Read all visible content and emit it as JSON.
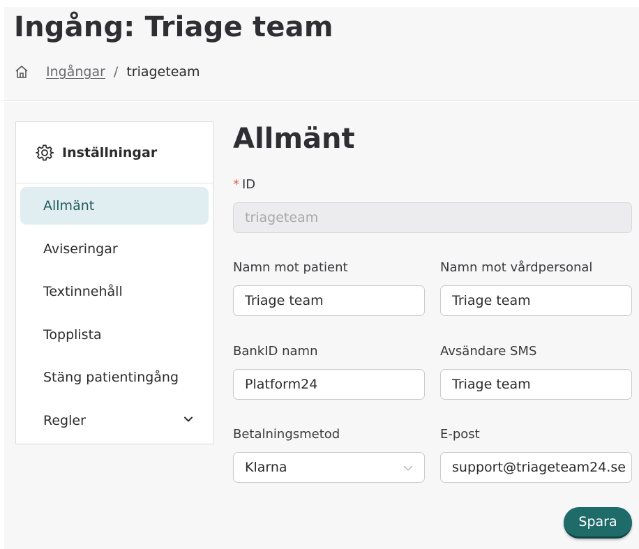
{
  "header": {
    "title": "Ingång: Triage team",
    "breadcrumb": {
      "home_icon": "home-icon",
      "link": "Ingångar",
      "separator": "/",
      "current": "triageteam"
    }
  },
  "sidebar": {
    "title": "Inställningar",
    "title_icon": "gear-icon",
    "items": [
      {
        "label": "Allmänt",
        "active": true
      },
      {
        "label": "Aviseringar"
      },
      {
        "label": "Textinnehåll"
      },
      {
        "label": "Topplista"
      },
      {
        "label": "Stäng patientingång"
      },
      {
        "label": "Regler",
        "icon": "chevron-down-icon"
      }
    ]
  },
  "main": {
    "title": "Allmänt",
    "fields": {
      "id": {
        "required_mark": "*",
        "label": "ID",
        "value": "triageteam"
      },
      "name_patient": {
        "label": "Namn mot patient",
        "value": "Triage team"
      },
      "name_staff": {
        "label": "Namn mot vårdpersonal",
        "value": "Triage team"
      },
      "bankid": {
        "label": "BankID namn",
        "value": "Platform24"
      },
      "sms_sender": {
        "label": "Avsändare SMS",
        "value": "Triage team"
      },
      "payment": {
        "label": "Betalningsmetod",
        "value": "Klarna",
        "icon": "chevron-down-icon"
      },
      "email": {
        "label": "E-post",
        "value": "support@triageteam24.se"
      }
    },
    "save_label": "Spara"
  },
  "colors": {
    "accent": "#1e6b6a",
    "active_bg": "#e1eef1",
    "required": "#e0544a"
  }
}
